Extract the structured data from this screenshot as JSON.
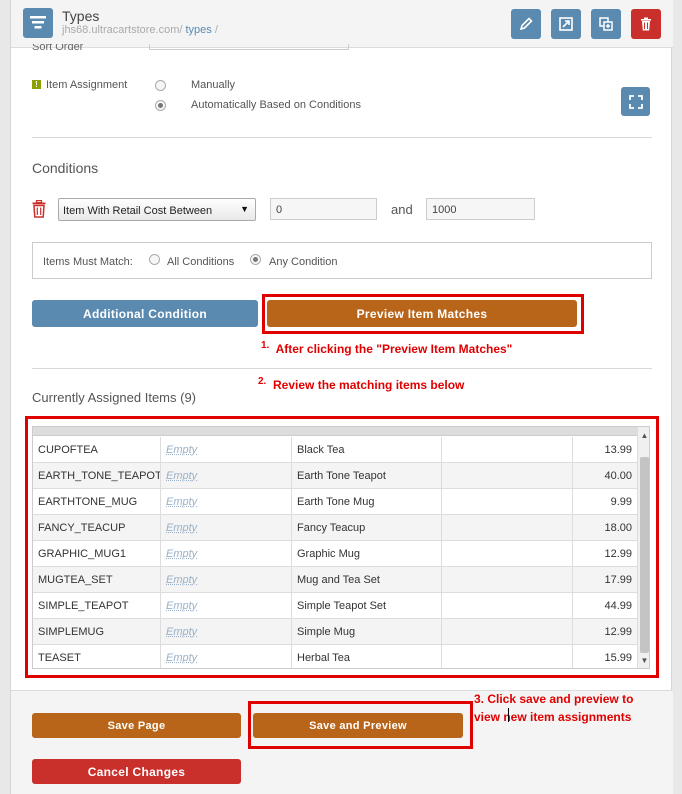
{
  "header": {
    "title": "Types",
    "breadcrumb_path": "jhs68.ultracartstore.com/",
    "breadcrumb_link": "types",
    "breadcrumb_sep": "/",
    "app_icon": "list-filter-icon",
    "actions": [
      "pencil-icon",
      "external-link-icon",
      "copy-icon",
      "trash-icon"
    ]
  },
  "form": {
    "sort_order_label": "Sort Order",
    "item_assignment_label": "Item Assignment",
    "assignment_options": [
      {
        "label": "Manually",
        "selected": false
      },
      {
        "label": "Automatically Based on Conditions",
        "selected": true
      }
    ]
  },
  "conditions": {
    "heading": "Conditions",
    "condition_type": "Item With Retail Cost Between",
    "min_value": "0",
    "and_label": "and",
    "max_value": "1000",
    "match_label": "Items Must Match:",
    "match_options": [
      {
        "label": "All Conditions",
        "selected": false
      },
      {
        "label": "Any Condition",
        "selected": true
      }
    ]
  },
  "buttons": {
    "additional_condition": "Additional Condition",
    "preview_matches": "Preview Item Matches",
    "save_page": "Save Page",
    "save_and_preview": "Save and Preview",
    "cancel_changes": "Cancel Changes"
  },
  "annotations": {
    "note1_num": "1.",
    "note1_text": "After clicking the \"Preview Item Matches\"",
    "note2_num": "2.",
    "note2_text": "Review the matching items below",
    "note3_line1": "3. Click save and preview to",
    "note3_line2": "view new item assignments"
  },
  "assigned": {
    "heading": "Currently Assigned Items (9)",
    "rows": [
      {
        "item_id": "CUPOFTEA",
        "empty": "Empty",
        "description": "Black Tea",
        "price": "13.99"
      },
      {
        "item_id": "EARTH_TONE_TEAPOT",
        "empty": "Empty",
        "description": "Earth Tone Teapot",
        "price": "40.00"
      },
      {
        "item_id": "EARTHTONE_MUG",
        "empty": "Empty",
        "description": "Earth Tone Mug",
        "price": "9.99"
      },
      {
        "item_id": "FANCY_TEACUP",
        "empty": "Empty",
        "description": "Fancy Teacup",
        "price": "18.00"
      },
      {
        "item_id": "GRAPHIC_MUG1",
        "empty": "Empty",
        "description": "Graphic Mug",
        "price": "12.99"
      },
      {
        "item_id": "MUGTEA_SET",
        "empty": "Empty",
        "description": "Mug and Tea Set",
        "price": "17.99"
      },
      {
        "item_id": "SIMPLE_TEAPOT",
        "empty": "Empty",
        "description": "Simple Teapot Set",
        "price": "44.99"
      },
      {
        "item_id": "SIMPLEMUG",
        "empty": "Empty",
        "description": "Simple Mug",
        "price": "12.99"
      },
      {
        "item_id": "TEASET",
        "empty": "Empty",
        "description": "Herbal Tea",
        "price": "15.99"
      }
    ]
  },
  "colors": {
    "accent_blue": "#5b8ab0",
    "orange": "#b8651a",
    "danger_red": "#c9302c",
    "annotation_red": "#e00000"
  }
}
